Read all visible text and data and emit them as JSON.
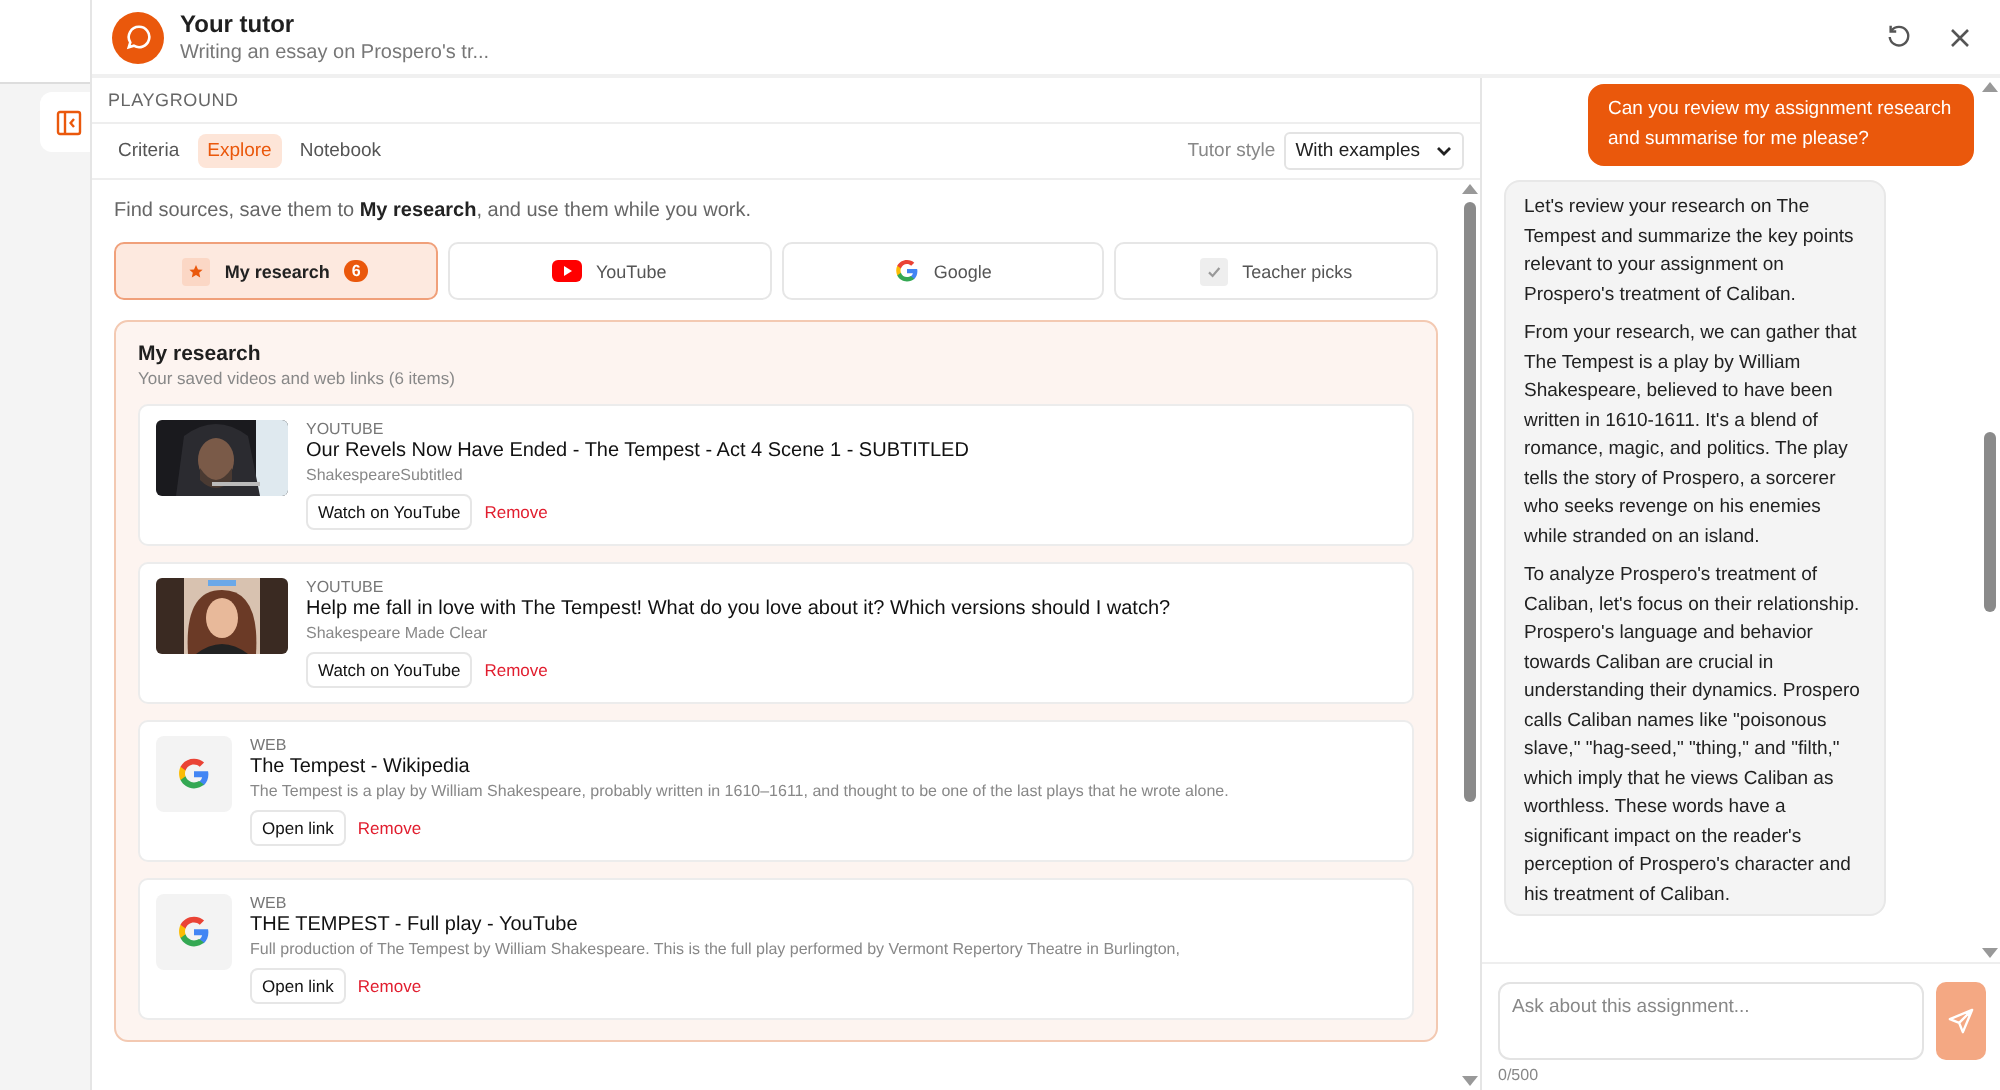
{
  "header": {
    "title": "Your tutor",
    "subtitle": "Writing an essay on Prospero's tr..."
  },
  "section_label": "PLAYGROUND",
  "tabs": [
    {
      "label": "Criteria",
      "selected": false
    },
    {
      "label": "Explore",
      "selected": true
    },
    {
      "label": "Notebook",
      "selected": false
    }
  ],
  "tutor_style": {
    "label": "Tutor style",
    "value": "With examples"
  },
  "intro": "Find sources, save them to **My research**, and use them while you work.",
  "sources": [
    {
      "kind": "research",
      "label": "My research",
      "badge": "6",
      "selected": true
    },
    {
      "kind": "youtube",
      "label": "YouTube",
      "selected": false
    },
    {
      "kind": "google",
      "label": "Google",
      "selected": false
    },
    {
      "kind": "teacher",
      "label": "Teacher picks",
      "selected": false
    }
  ],
  "research": {
    "title": "My research",
    "subtitle": "Your saved videos and web links (6 items)",
    "items": [
      {
        "kind": "video",
        "source": "YOUTUBE",
        "title": "Our Revels Now Have Ended - The Tempest - Act 4 Scene 1 - SUBTITLED",
        "meta": "ShakespeareSubtitled",
        "action": "Watch on YouTube",
        "remove": "Remove"
      },
      {
        "kind": "video",
        "source": "YOUTUBE",
        "title": "Help me fall in love with The Tempest! What do you love about it? Which versions should I watch?",
        "meta": "Shakespeare Made Clear",
        "action": "Watch on YouTube",
        "remove": "Remove"
      },
      {
        "kind": "web",
        "source": "WEB",
        "title": "The Tempest - Wikipedia",
        "meta": "The Tempest is a play by William Shakespeare, probably written in 1610–1611, and thought to be one of the last plays that he wrote alone.",
        "action": "Open link",
        "remove": "Remove"
      },
      {
        "kind": "web",
        "source": "WEB",
        "title": "THE TEMPEST - Full play - YouTube",
        "meta": "Full production of The Tempest by William Shakespeare. This is the full play performed by Vermont Repertory Theatre in Burlington,",
        "action": "Open link",
        "remove": "Remove"
      }
    ]
  },
  "chat": {
    "messages": [
      {
        "kind": "user",
        "paragraphs": [
          "Can you review my assignment research and summarise for me please?"
        ]
      },
      {
        "kind": "tutor",
        "paragraphs": [
          "Let's review your research on The Tempest and summarize the key points relevant to your assignment on Prospero's treatment of Caliban.",
          "From your research, we can gather that The Tempest is a play by William Shakespeare, believed to have been written in 1610-1611. It's a blend of romance, magic, and politics. The play tells the story of Prospero, a sorcerer who seeks revenge on his enemies while stranded on an island.",
          "To analyze Prospero's treatment of Caliban, let's focus on their relationship. Prospero's language and behavior towards Caliban are crucial in understanding their dynamics. Prospero calls Caliban names like \"poisonous slave,\" \"hag-seed,\" \"thing,\" and \"filth,\" which imply that he views Caliban as worthless. These words have a significant impact on the reader's perception of Prospero's character and his treatment of Caliban."
        ]
      }
    ],
    "input": {
      "placeholder": "Ask about this assignment..."
    },
    "counter": "0/500"
  }
}
